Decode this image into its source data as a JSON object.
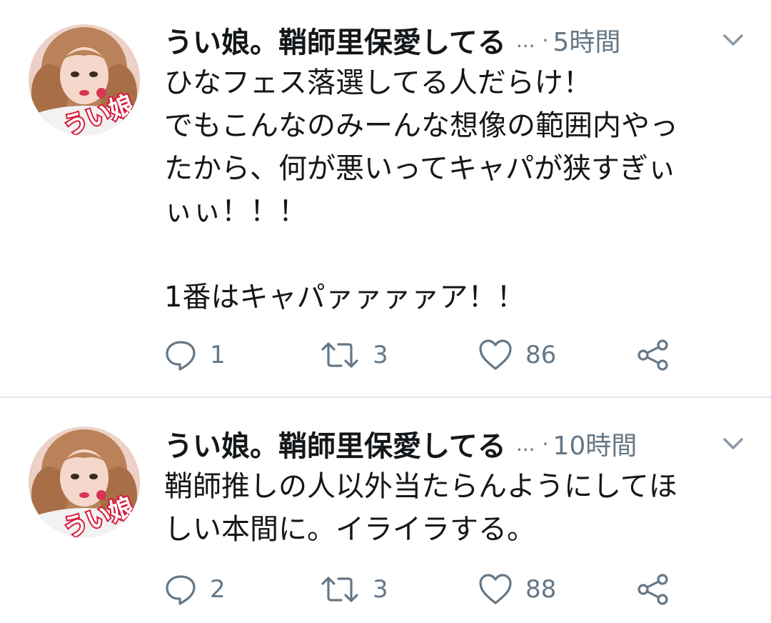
{
  "colors": {
    "text": "#14171a",
    "secondary": "#657786",
    "divider": "#e1e8ed",
    "avatar_ring": "#d91a3a"
  },
  "tweets": [
    {
      "display_name": "うい娘。鞘師里保愛してる",
      "ellipsis": "...",
      "separator": "·",
      "time": "5時間",
      "text_lines": [
        "ひなフェス落選してる人だらけ！",
        "でもこんなのみーんな想像の範囲内やっ",
        "たから、何が悪いってキャパが狭すぎぃ",
        "ぃぃ！！！",
        "",
        "1番はキャパァァァァア！！"
      ],
      "reply_count": "1",
      "retweet_count": "3",
      "like_count": "86",
      "avatar_text": "うい娘。"
    },
    {
      "display_name": "うい娘。鞘師里保愛してる",
      "ellipsis": "...",
      "separator": "·",
      "time": "10時間",
      "text_lines": [
        "鞘師推しの人以外当たらんようにしてほ",
        "しい本間に。イライラする。"
      ],
      "reply_count": "2",
      "retweet_count": "3",
      "like_count": "88",
      "avatar_text": "うい娘。"
    }
  ],
  "icons": {
    "reply": "reply-icon",
    "retweet": "retweet-icon",
    "like": "heart-icon",
    "share": "share-icon",
    "menu": "chevron-down-icon"
  }
}
